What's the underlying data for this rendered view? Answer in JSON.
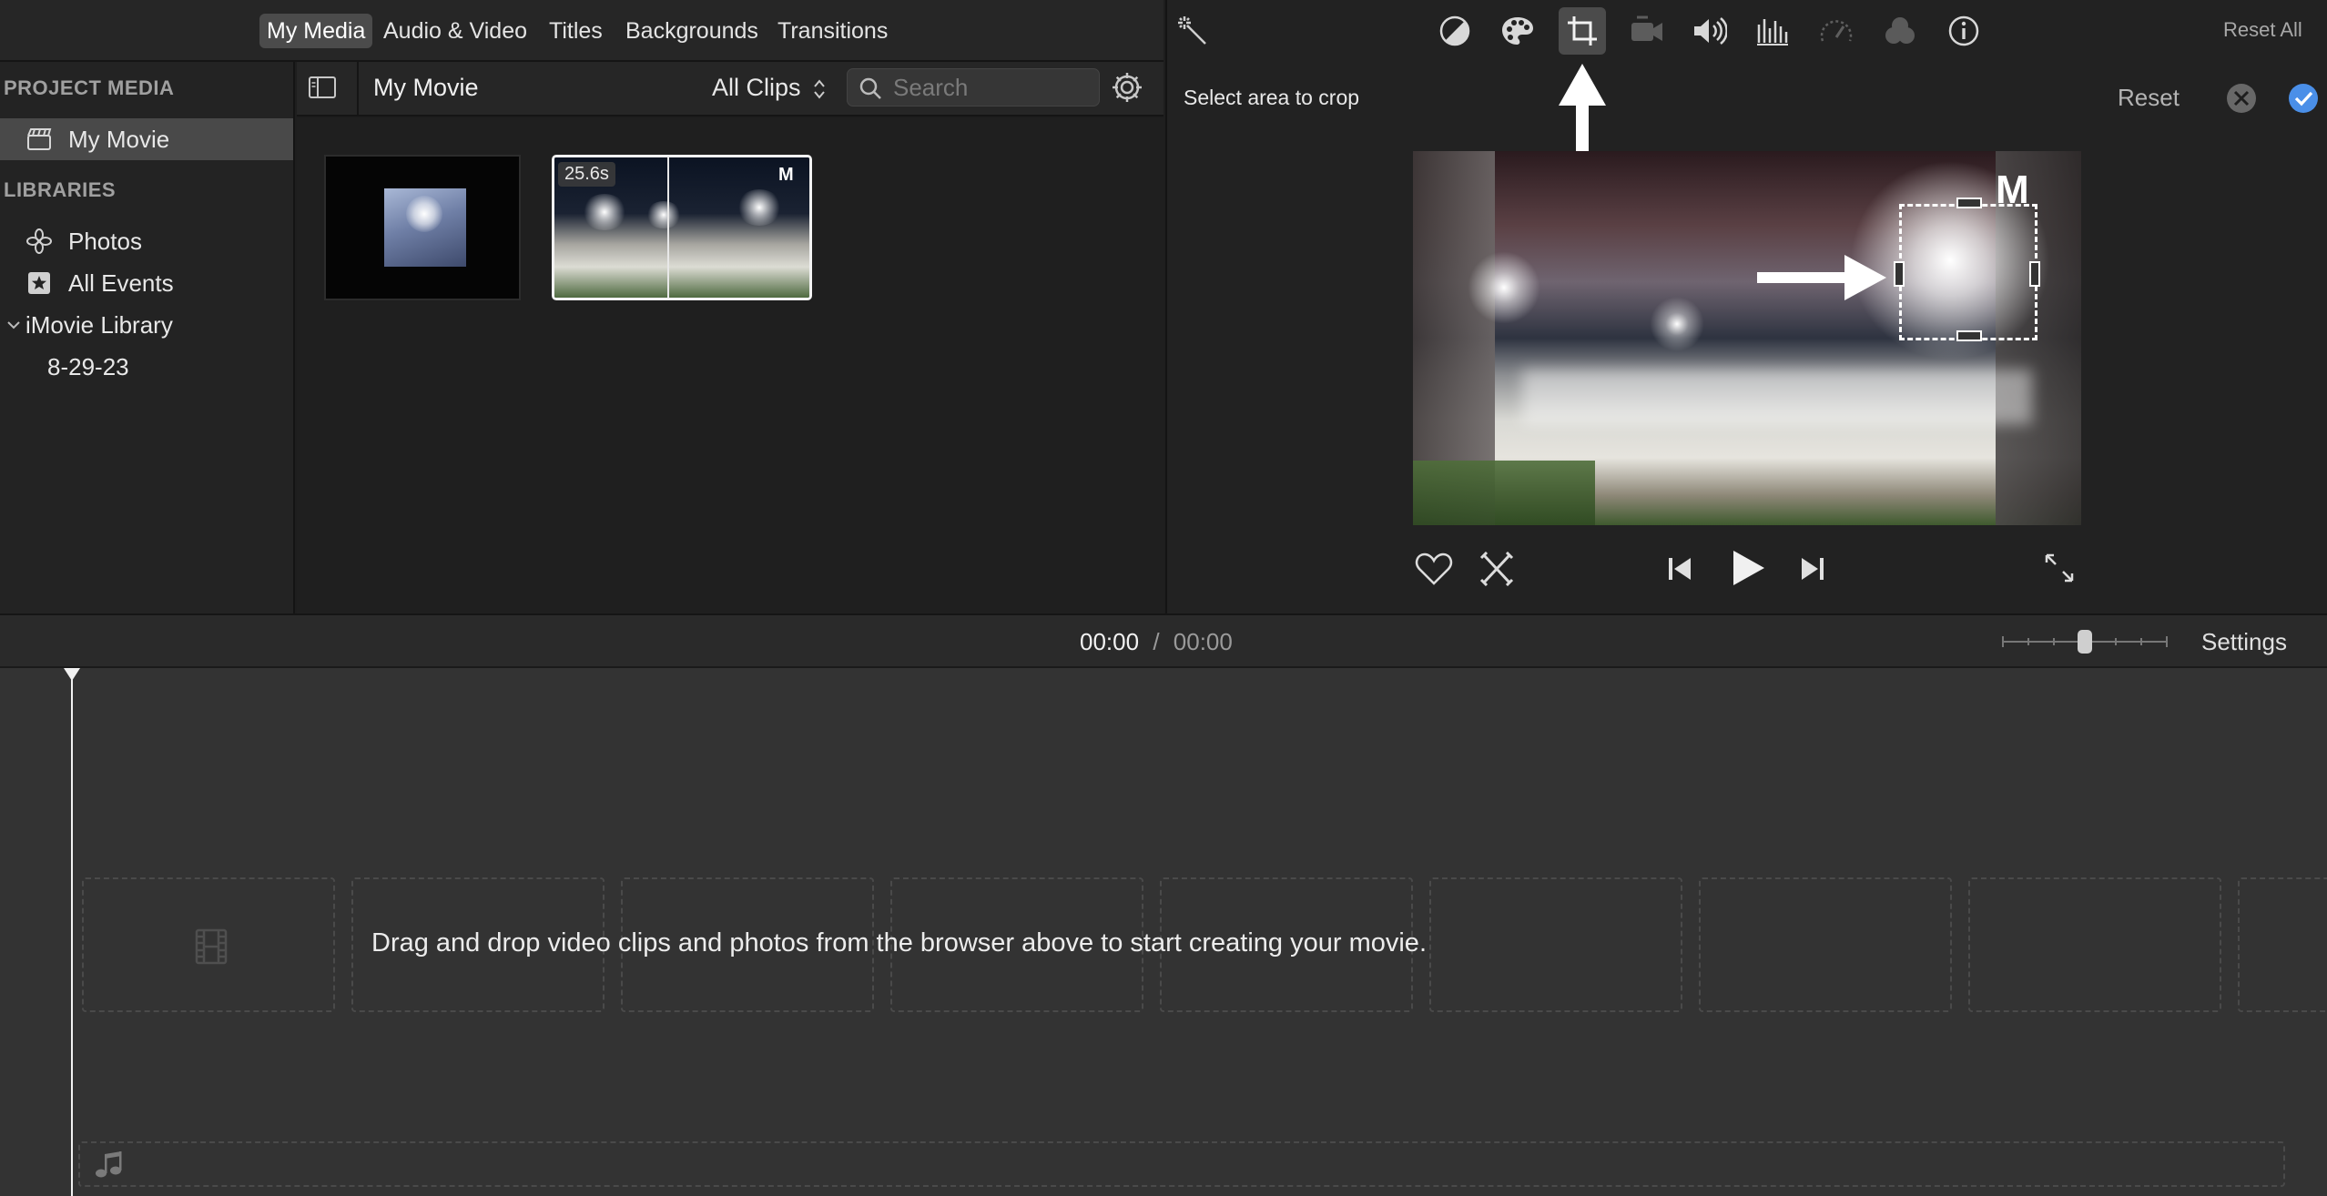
{
  "top_tabs": [
    "My Media",
    "Audio & Video",
    "Titles",
    "Backgrounds",
    "Transitions"
  ],
  "sidebar": {
    "project_media_header": "PROJECT MEDIA",
    "project_item": "My Movie",
    "libraries_header": "LIBRARIES",
    "photos": "Photos",
    "all_events": "All Events",
    "imovie_library": "iMovie Library",
    "event_date": "8-29-23"
  },
  "browser": {
    "title": "My Movie",
    "filter": "All Clips",
    "search_placeholder": "Search",
    "clip2_duration": "25.6s"
  },
  "viewer": {
    "reset_all": "Reset All",
    "instruction": "Select area to crop",
    "reset": "Reset",
    "tool_icons": [
      "magic-wand-icon",
      "color-balance-icon",
      "color-correction-icon",
      "crop-icon",
      "stabilization-icon",
      "volume-icon",
      "noise-reduction-icon",
      "speed-icon",
      "clip-filter-icon",
      "info-icon"
    ],
    "active_tool": "crop-icon"
  },
  "timeline": {
    "current_time": "00:00",
    "separator": "/",
    "total_time": "00:00",
    "settings": "Settings",
    "empty_message": "Drag and drop video clips and photos from the browser above to start creating your movie."
  },
  "colors": {
    "accent_blue": "#4a8fe8",
    "annotation_arrow": "#ffffff",
    "panel_bg": "#1e1e1e",
    "timeline_bg": "#333333"
  }
}
